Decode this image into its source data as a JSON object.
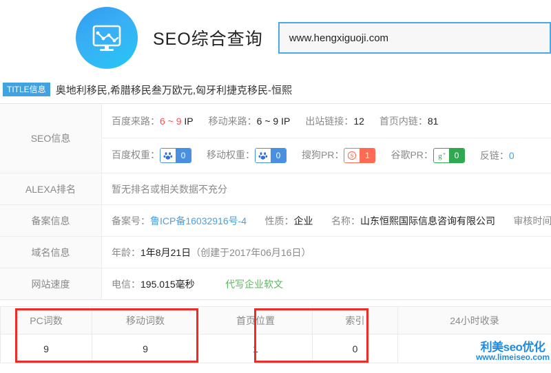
{
  "header": {
    "logo_icon": "monitor-chart-icon",
    "site_title": "SEO综合查询",
    "url_value": "www.hengxiguoji.com"
  },
  "title_info": {
    "badge": "TITLE信息",
    "text": "奥地利移民,希腊移民叁万欧元,匈牙利捷克移民-恒熙"
  },
  "info": {
    "seo": {
      "label": "SEO信息",
      "line1": [
        {
          "key": "百度来路：",
          "value": "6 ~ 9",
          "unit": " IP",
          "style": "red"
        },
        {
          "key": "移动来路：",
          "value": "6 ~ 9",
          "unit": " IP",
          "style": "dark"
        },
        {
          "key": "出站链接：",
          "value": "12",
          "unit": "",
          "style": "dark"
        },
        {
          "key": "首页内链：",
          "value": "81",
          "unit": "",
          "style": "dark"
        }
      ],
      "weights": [
        {
          "key": "百度权重：",
          "icon": "baidu-paw-icon",
          "value": "0",
          "color": "blue"
        },
        {
          "key": "移动权重：",
          "icon": "baidu-mobile-paw-icon",
          "value": "0",
          "color": "blue"
        },
        {
          "key": "搜狗PR：",
          "icon": "sogou-s-icon",
          "value": "1",
          "color": "red"
        },
        {
          "key": "谷歌PR：",
          "icon": "google-plus-icon",
          "value": "0",
          "color": "green"
        }
      ],
      "backlink": {
        "key": "反链：",
        "value": "0"
      }
    },
    "alexa": {
      "label": "ALEXA排名",
      "value": "暂无排名或相关数据不充分"
    },
    "icp": {
      "label": "备案信息",
      "number_key": "备案号：",
      "number_value": "鲁ICP备16032916号-4",
      "nature_key": "性质：",
      "nature_value": "企业",
      "name_key": "名称：",
      "name_value": "山东恒熙国际信息咨询有限公司",
      "audit_key": "审核时间"
    },
    "domain": {
      "label": "域名信息",
      "age_key": "年龄：",
      "age_value": "1年8月21日",
      "created": "（创建于2017年06月16日）"
    },
    "speed": {
      "label": "网站速度",
      "key": "电信：",
      "value": "195.015毫秒",
      "link": "代写企业软文"
    }
  },
  "bottom_table": {
    "columns": [
      "PC词数",
      "移动词数",
      "首页位置",
      "索引",
      "24小时收录"
    ],
    "values": [
      "9",
      "9",
      "1",
      "0",
      ""
    ]
  },
  "watermark": {
    "line1": "利美seo优化",
    "line2": "www.limeiseo.com"
  },
  "colors": {
    "accent_blue": "#42a2e0",
    "badge_blue": "#4a90e2",
    "badge_red": "#ff6b52",
    "badge_green": "#2fa84f",
    "highlight_red": "#ef2b26",
    "link_green": "#5cb85c"
  }
}
